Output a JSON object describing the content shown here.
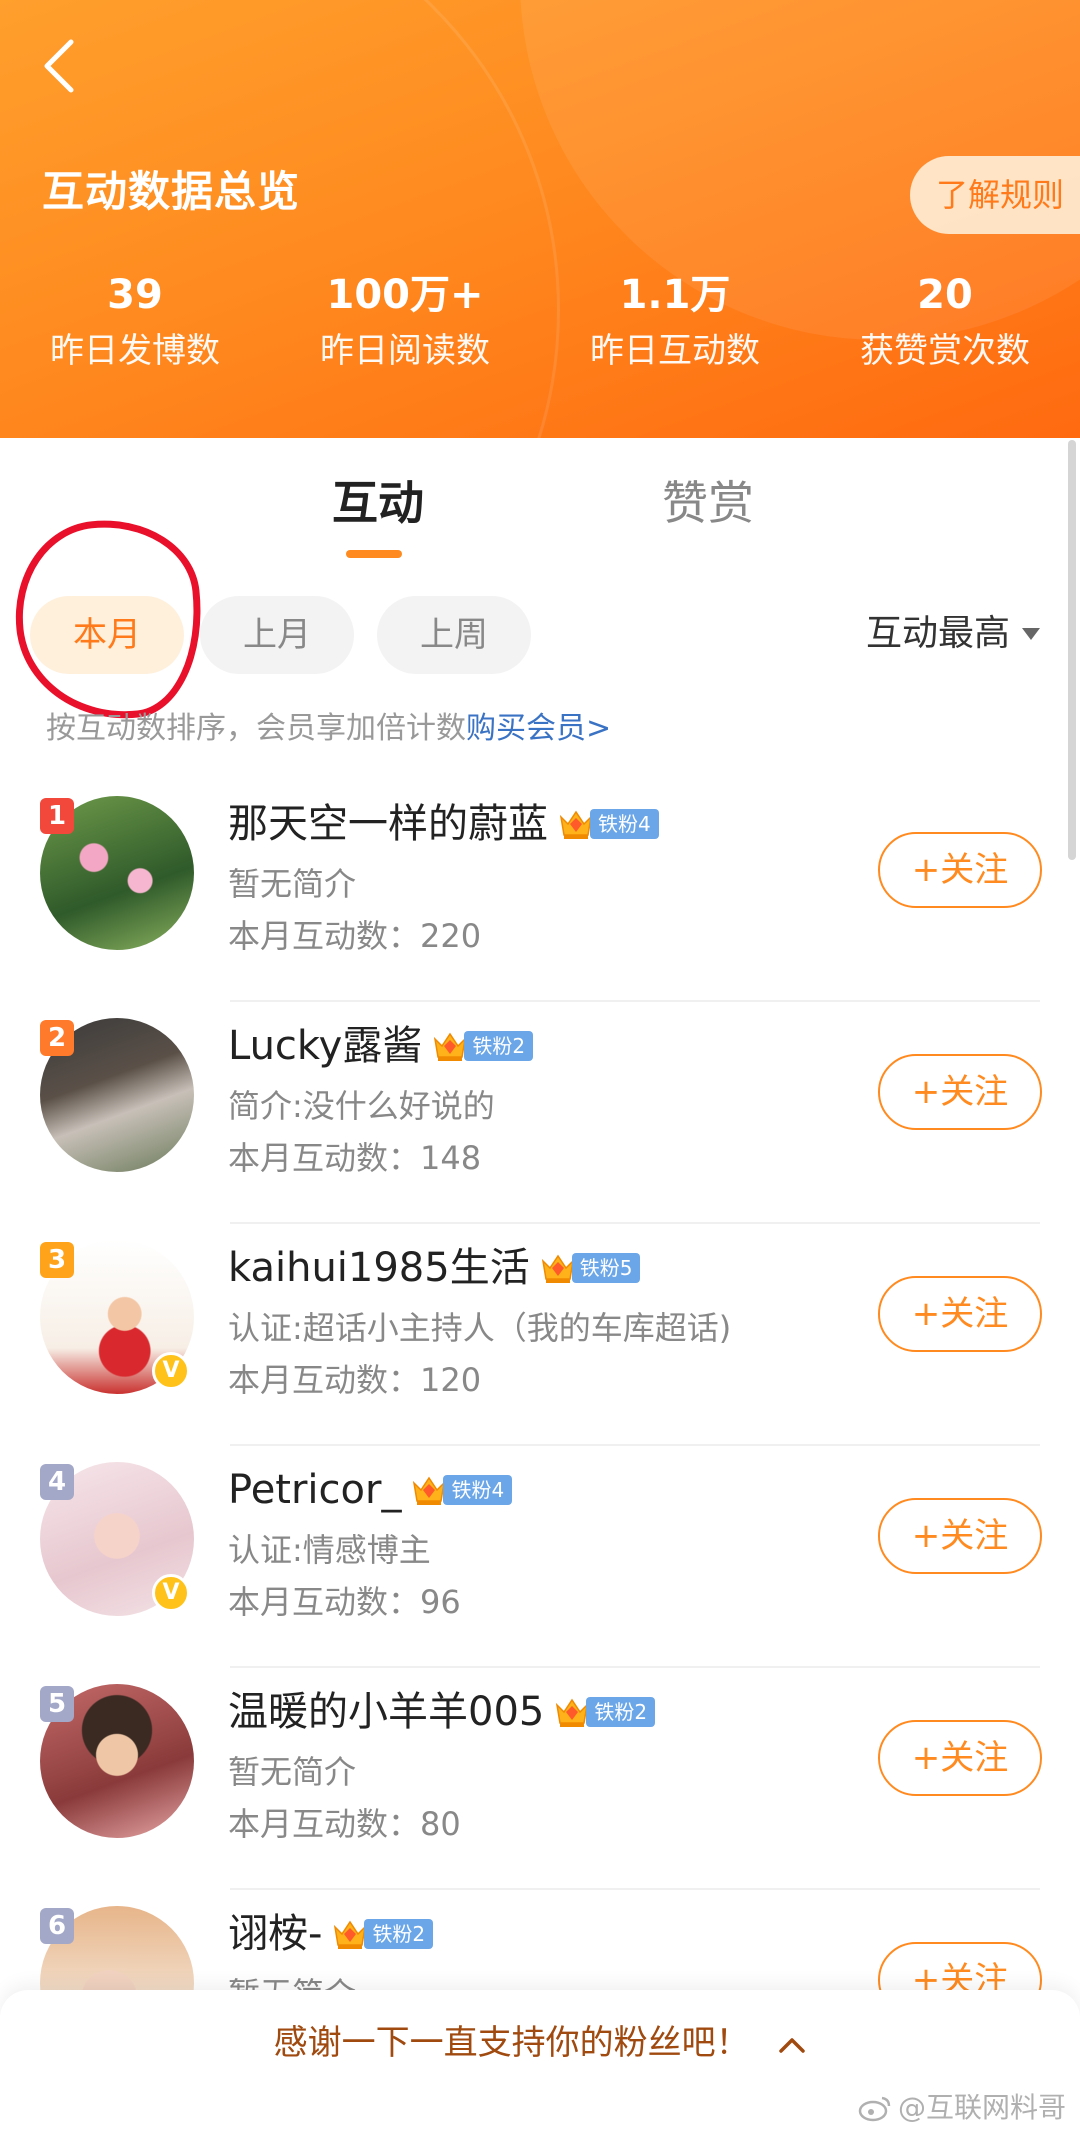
{
  "header": {
    "title": "互动数据总览",
    "rules_button": "了解规则",
    "stats": [
      {
        "value": "39",
        "label": "昨日发博数"
      },
      {
        "value": "100万+",
        "label": "昨日阅读数"
      },
      {
        "value": "1.1万",
        "label": "昨日互动数"
      },
      {
        "value": "20",
        "label": "获赞赏次数"
      }
    ]
  },
  "tabs": {
    "active": "互动",
    "inactive": "赞赏"
  },
  "filters": {
    "this_month": "本月",
    "last_month": "上月",
    "last_week": "上周"
  },
  "sort": {
    "label": "互动最高"
  },
  "hint": {
    "text": "按互动数排序，会员享加倍计数",
    "link": "购买会员>"
  },
  "fans": [
    {
      "rank": "1",
      "name": "那天空一样的蔚蓝",
      "fan_level": "铁粉4",
      "bio": "暂无简介",
      "count": "本月互动数：220",
      "follow": "+关注",
      "rank_color": "#f2483b"
    },
    {
      "rank": "2",
      "name": "Lucky露酱",
      "fan_level": "铁粉2",
      "bio": "简介:没什么好说的",
      "count": "本月互动数：148",
      "follow": "+关注",
      "rank_color": "#ff7a2a"
    },
    {
      "rank": "3",
      "name": "kaihui1985生活",
      "fan_level": "铁粉5",
      "bio": "认证:超话小主持人（我的车库超话)",
      "count": "本月互动数：120",
      "follow": "+关注",
      "rank_color": "#ffa41a"
    },
    {
      "rank": "4",
      "name": "Petricor_",
      "fan_level": "铁粉4",
      "bio": "认证:情感博主",
      "count": "本月互动数：96",
      "follow": "+关注",
      "rank_color": "#a3a8c8"
    },
    {
      "rank": "5",
      "name": "温暖的小羊羊005",
      "fan_level": "铁粉2",
      "bio": "暂无简介",
      "count": "本月互动数：80",
      "follow": "+关注",
      "rank_color": "#a3a8c8"
    },
    {
      "rank": "6",
      "name": "诩桉-",
      "fan_level": "铁粉2",
      "bio": "暂无简介",
      "count": "",
      "follow": "+关注",
      "rank_color": "#a3a8c8"
    }
  ],
  "bottom": {
    "thanks": "感谢一下一直支持你的粉丝吧！",
    "watermark": "@互联网料哥"
  },
  "colors": {
    "accent": "#ff8a1f",
    "link": "#3a72c4",
    "annotation": "#e8102a"
  }
}
